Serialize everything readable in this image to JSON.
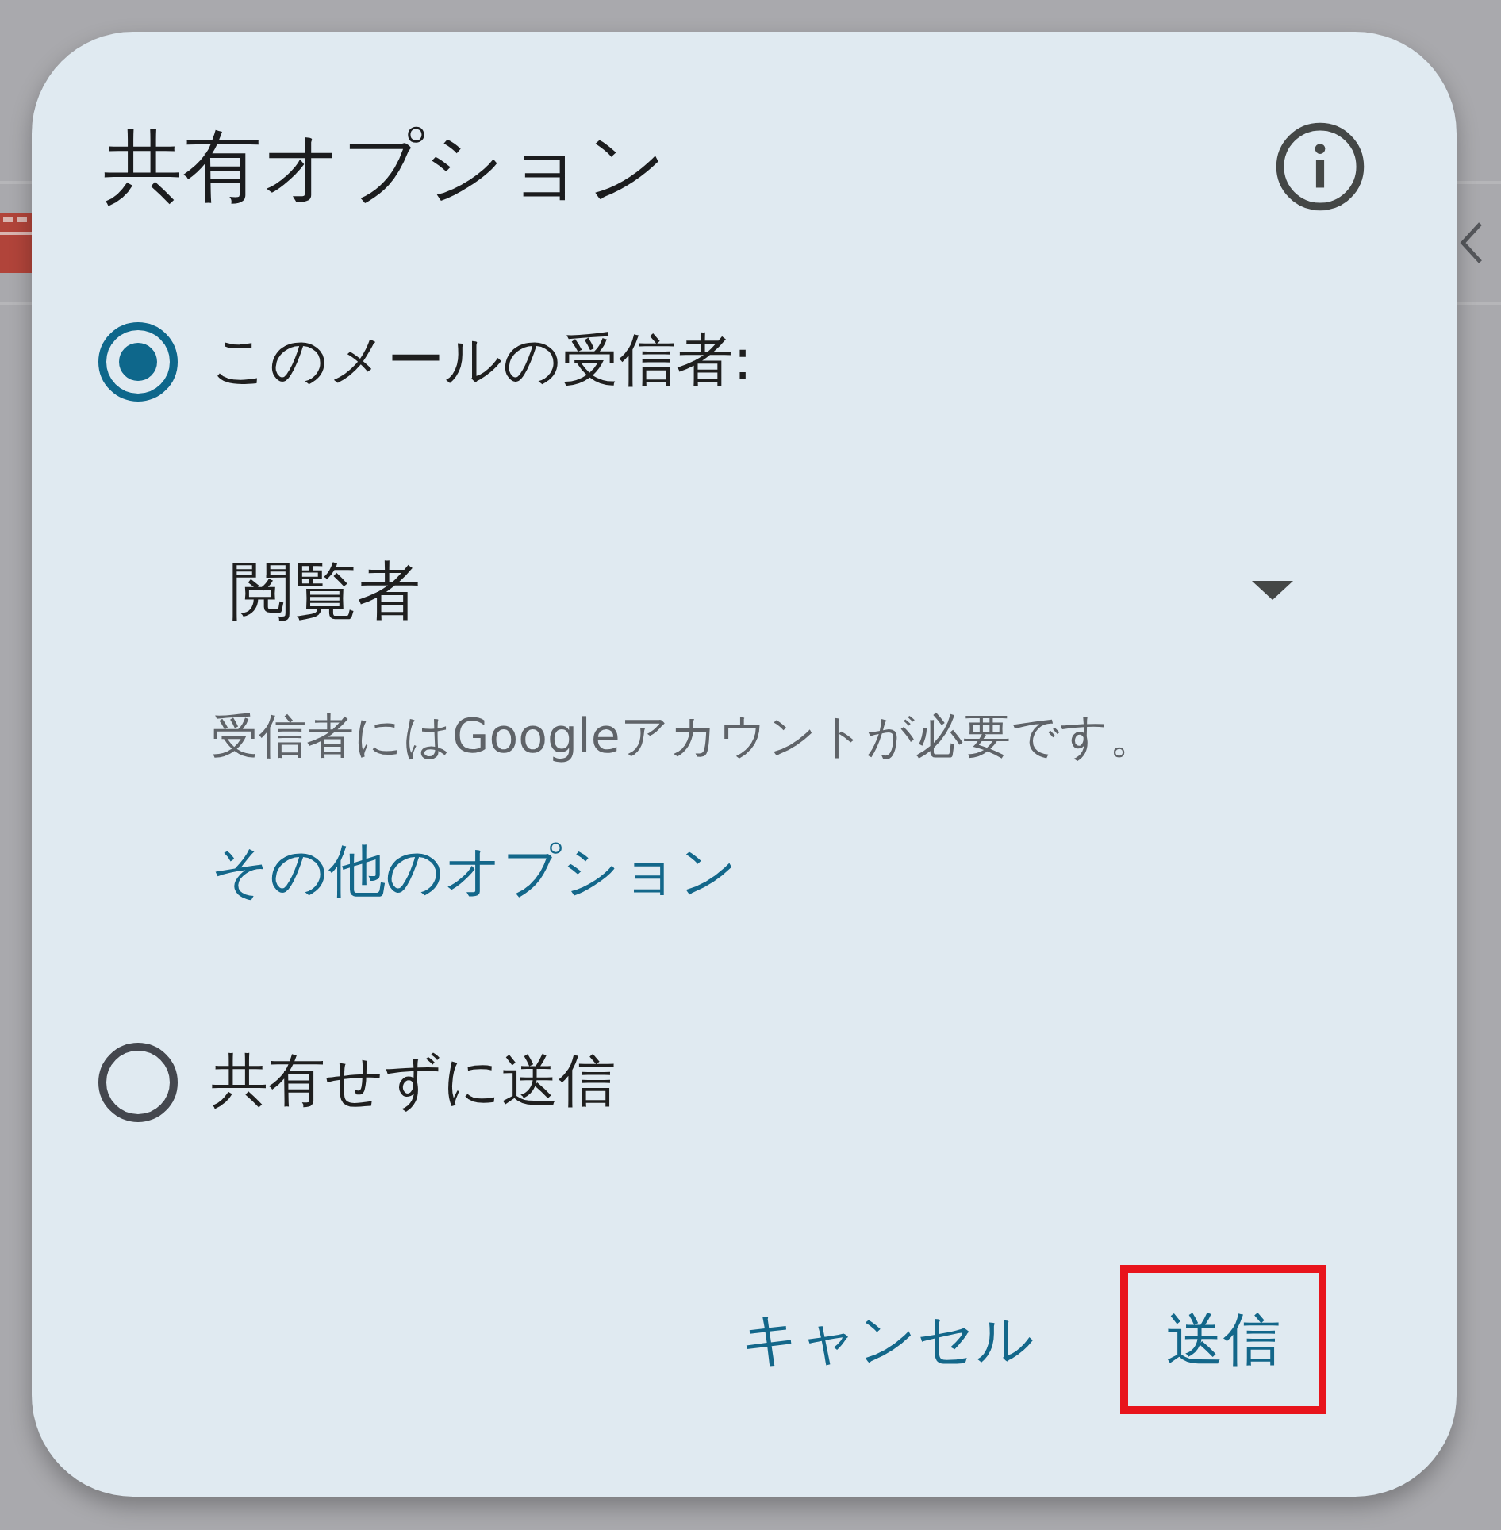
{
  "dialog": {
    "title": "共有オプション",
    "options": [
      {
        "label": "このメールの受信者:",
        "selected": true,
        "dropdown": {
          "value": "閲覧者"
        },
        "note": "受信者にはGoogleアカウントが必要です。",
        "link": "その他のオプション"
      },
      {
        "label": "共有せずに送信",
        "selected": false
      }
    ],
    "buttons": [
      {
        "label": "キャンセル",
        "highlighted": false
      },
      {
        "label": "送信",
        "highlighted": true
      }
    ]
  }
}
